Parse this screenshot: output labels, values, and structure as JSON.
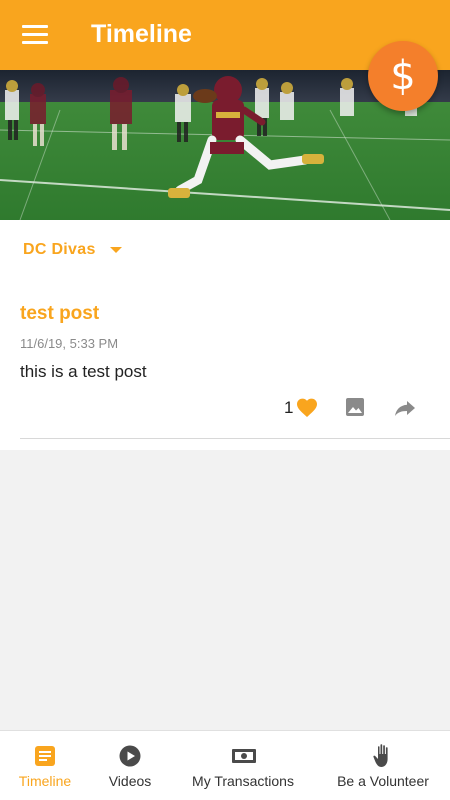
{
  "appbar": {
    "title": "Timeline",
    "menu_icon": "hamburger-icon"
  },
  "fab": {
    "symbol": "$",
    "icon": "dollar-icon"
  },
  "hero": {
    "alt": "football-photo"
  },
  "team_selector": {
    "label": "DC Divas"
  },
  "post": {
    "title": "test post",
    "date": "11/6/19, 5:33 PM",
    "body": "this is a test post",
    "likes": "1"
  },
  "bottom_nav": {
    "items": [
      {
        "label": "Timeline",
        "icon": "timeline-icon",
        "active": true
      },
      {
        "label": "Videos",
        "icon": "play-icon",
        "active": false
      },
      {
        "label": "My Transactions",
        "icon": "money-icon",
        "active": false
      },
      {
        "label": "Be a Volunteer",
        "icon": "hand-icon",
        "active": false
      }
    ]
  },
  "colors": {
    "accent": "#f9a51e",
    "fab": "#f47f2b",
    "background": "#f2f2f2"
  }
}
